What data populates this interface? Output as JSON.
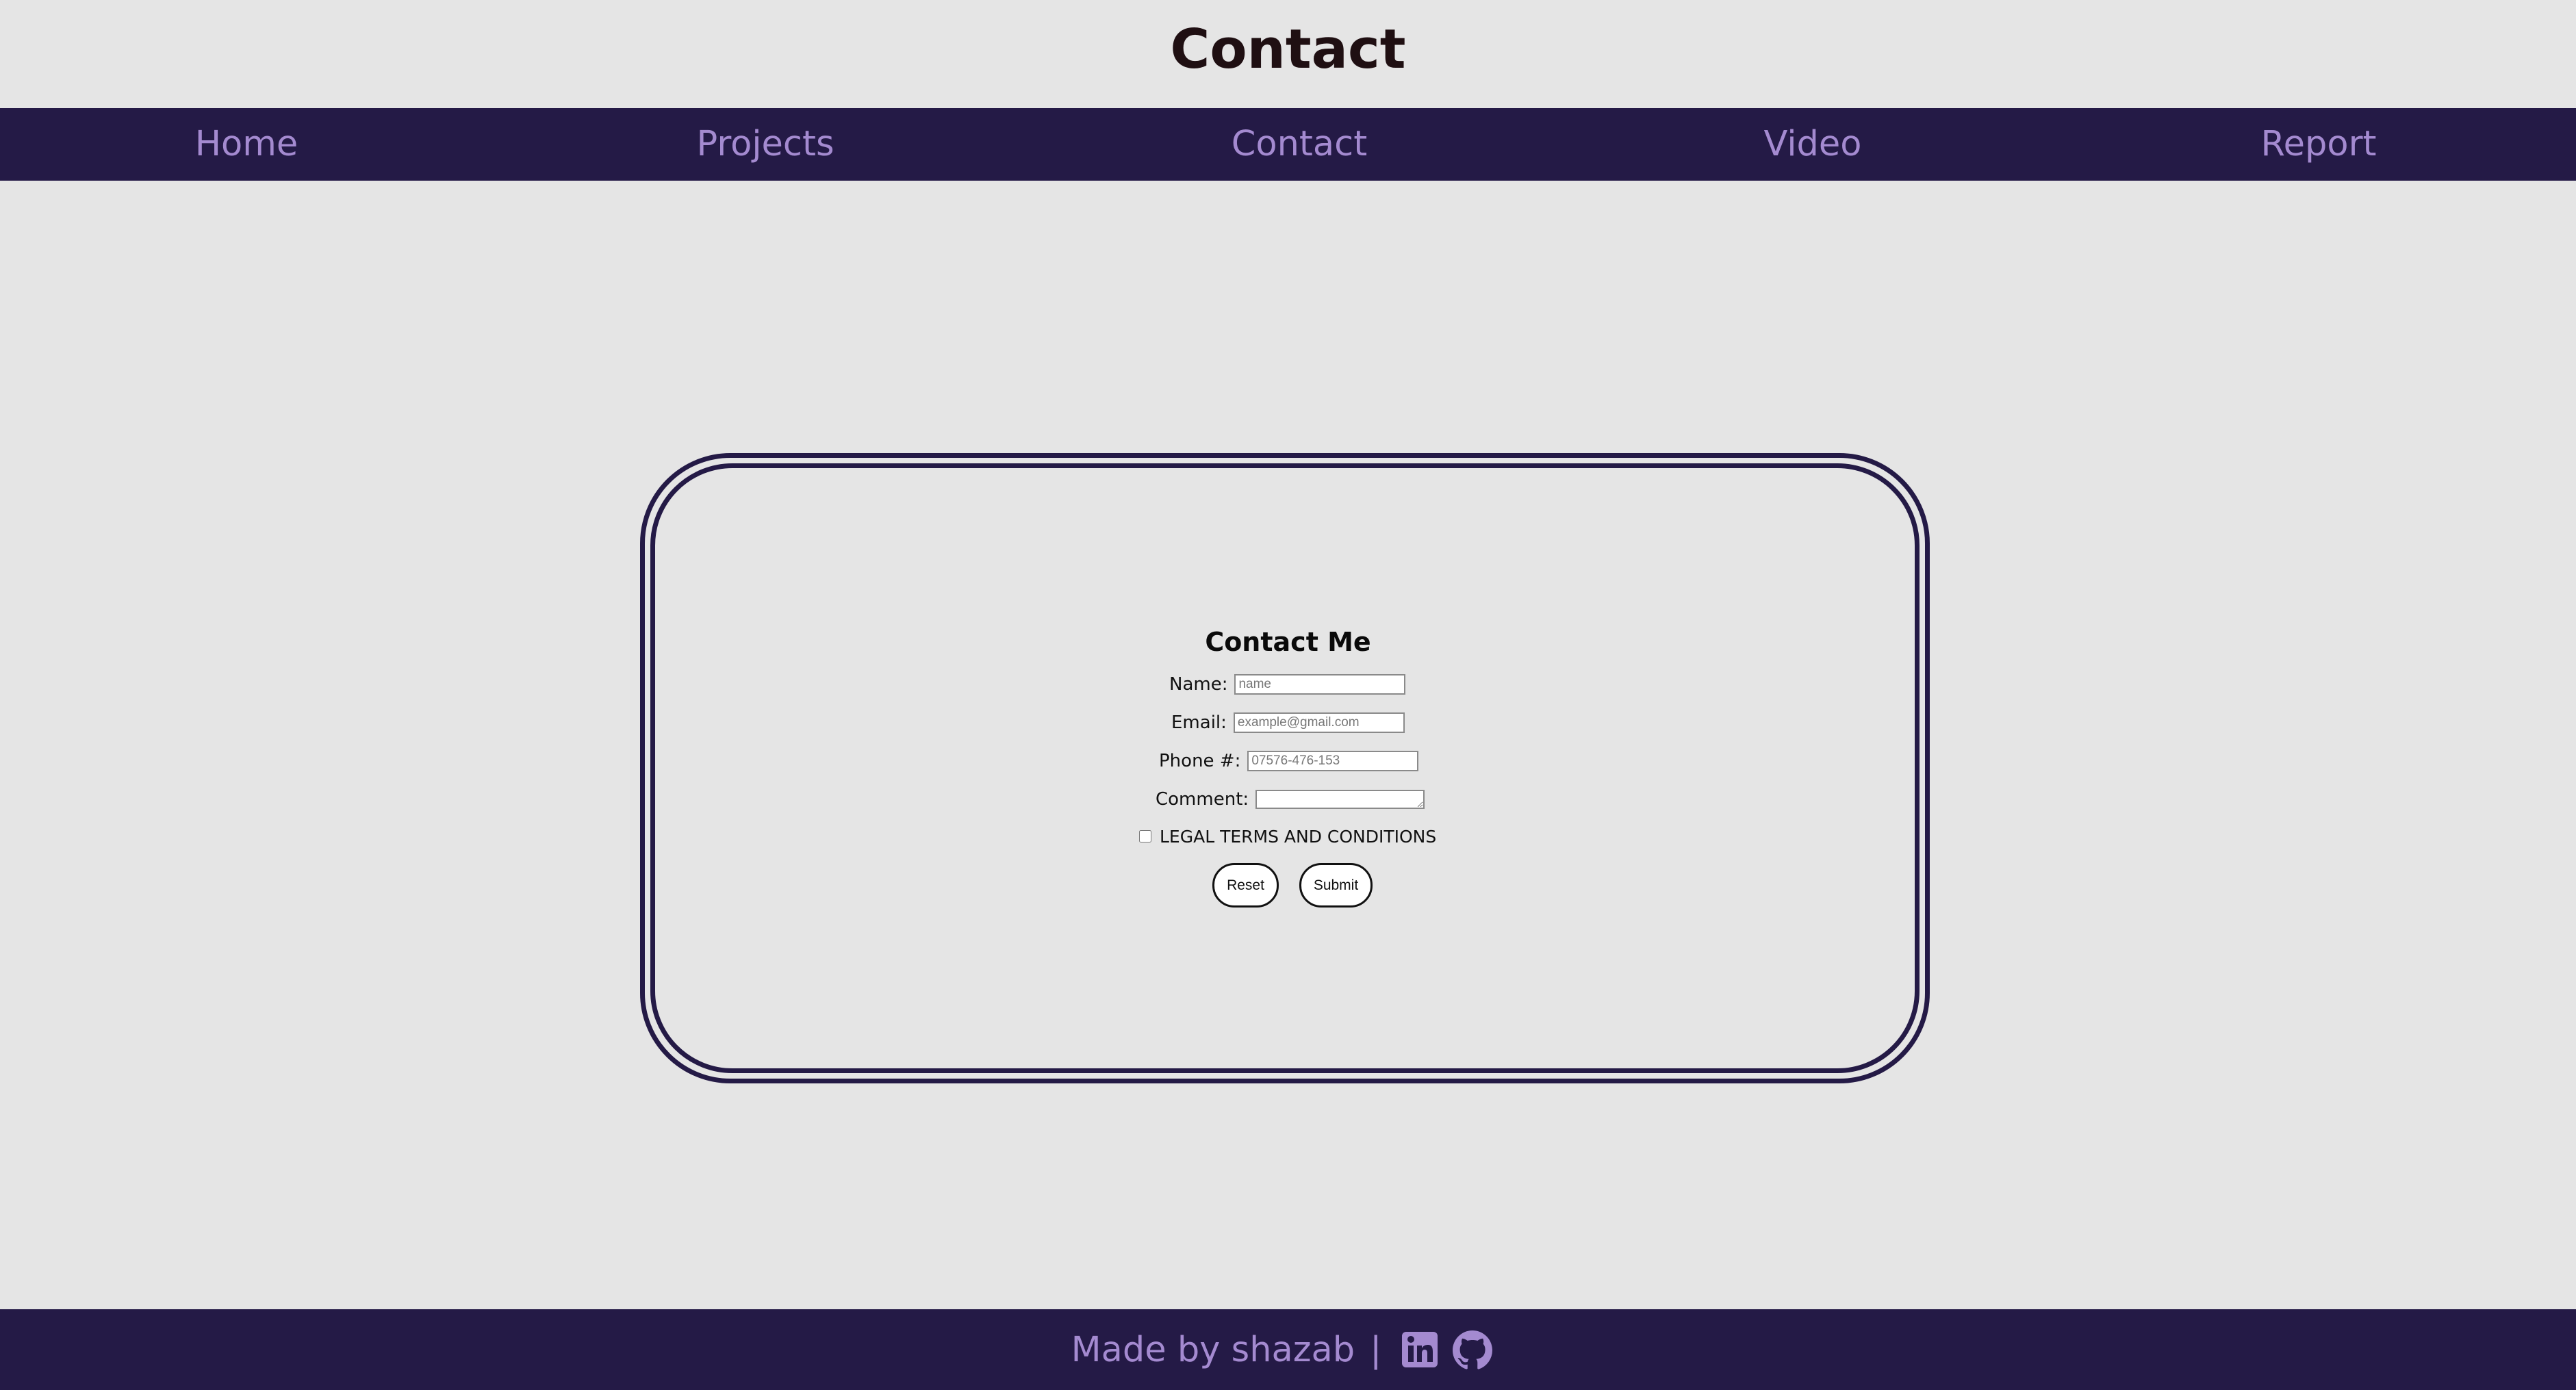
{
  "header": {
    "title": "Contact"
  },
  "nav": {
    "items": [
      {
        "label": "Home"
      },
      {
        "label": "Projects"
      },
      {
        "label": "Contact"
      },
      {
        "label": "Video"
      },
      {
        "label": "Report"
      }
    ]
  },
  "form": {
    "title": "Contact Me",
    "name": {
      "label": "Name:",
      "placeholder": "name",
      "value": ""
    },
    "email": {
      "label": "Email:",
      "placeholder": "example@gmail.com",
      "value": ""
    },
    "phone": {
      "label": "Phone #:",
      "placeholder": "07576-476-153",
      "value": ""
    },
    "comment": {
      "label": "Comment:",
      "value": ""
    },
    "terms": {
      "label": "LEGAL TERMS AND CONDITIONS",
      "checked": false
    },
    "reset_label": "Reset",
    "submit_label": "Submit"
  },
  "footer": {
    "text": "Made by shazab",
    "separator": "|",
    "icons": [
      "linkedin-icon",
      "github-icon"
    ]
  },
  "colors": {
    "background": "#e5e5e5",
    "nav_bg": "#241a46",
    "nav_text": "#a48ad0",
    "title_text": "#1f0f12",
    "card_border": "#241a46"
  }
}
